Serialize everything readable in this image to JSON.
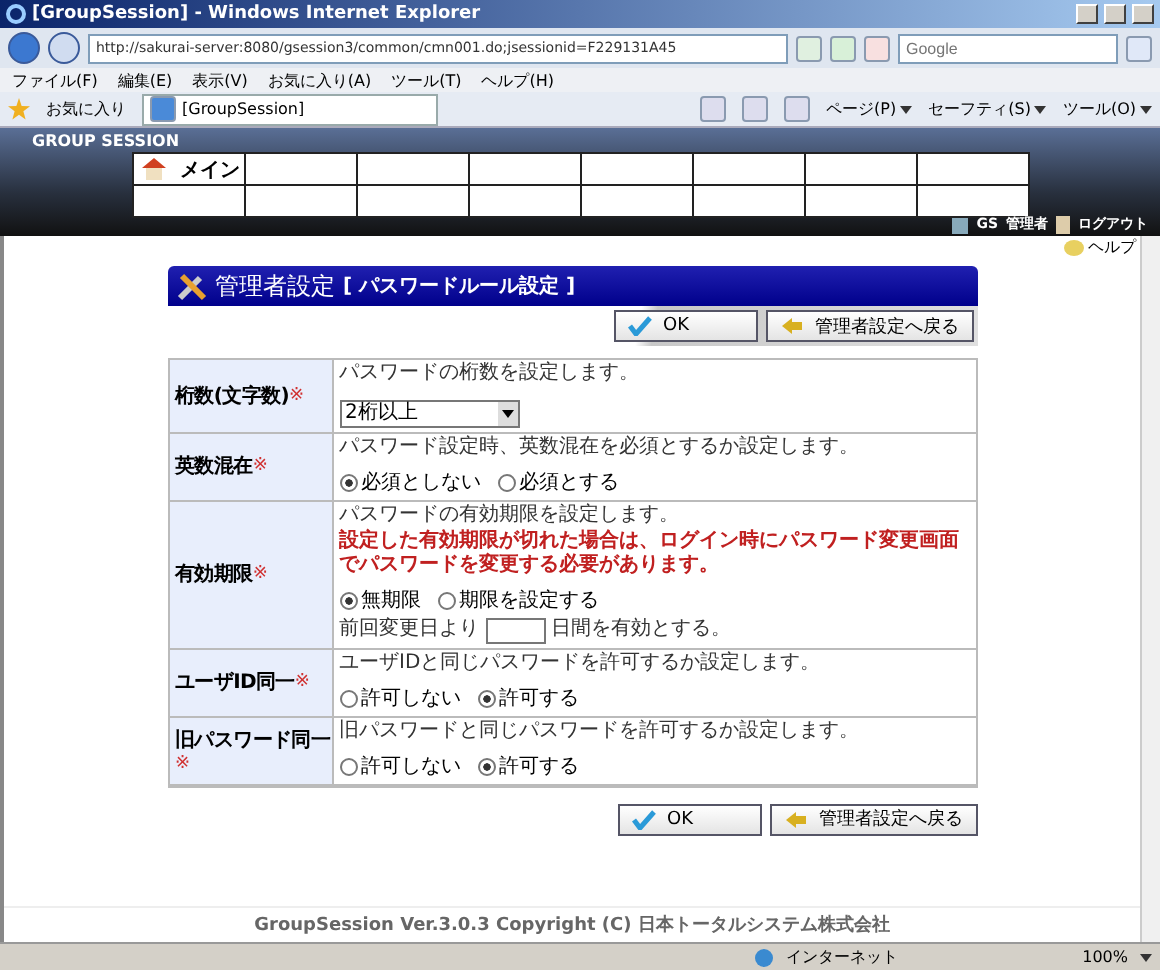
{
  "window": {
    "title": "[GroupSession] - Windows Internet Explorer"
  },
  "address_bar": {
    "url": "http://sakurai-server:8080/gsession3/common/cmn001.do;jsessionid=F229131A45",
    "search_placeholder": "Google"
  },
  "menu": [
    "ファイル(F)",
    "編集(E)",
    "表示(V)",
    "お気に入り(A)",
    "ツール(T)",
    "ヘルプ(H)"
  ],
  "favorites": {
    "label": "お気に入り",
    "tab": "[GroupSession]",
    "tools": [
      "ページ(P)",
      "セーフティ(S)",
      "ツール(O)"
    ]
  },
  "app": {
    "logo": "GROUP SESSION",
    "nav": [
      {
        "label": "メイン"
      }
    ],
    "user": "GS",
    "role": "管理者",
    "logout": "ログアウト",
    "help": "ヘルプ"
  },
  "page": {
    "title": "管理者設定",
    "subtitle": "[ パスワードルール設定 ]"
  },
  "buttons_top": [
    {
      "kind": "ok",
      "label": "OK"
    },
    {
      "kind": "back",
      "label": "管理者設定へ戻る"
    }
  ],
  "rows": [
    {
      "label": "桁数(文字数)",
      "required_mark": "※",
      "description": "パスワードの桁数を設定します。",
      "control": {
        "kind": "select",
        "value": "2桁以上"
      }
    },
    {
      "label": "英数混在",
      "required_mark": "※",
      "description": "パスワード設定時、英数混在を必須とするか設定します。",
      "control": {
        "kind": "radio",
        "options": [
          {
            "label": "必須としない",
            "selected": true
          },
          {
            "label": "必須とする",
            "selected": false
          }
        ]
      }
    },
    {
      "label": "有効期限",
      "required_mark": "※",
      "description": "パスワードの有効期限を設定します。",
      "warning": "設定した有効期限が切れた場合は、ログイン時にパスワード変更画面でパスワードを変更する必要があります。",
      "control": {
        "kind": "radio",
        "options": [
          {
            "label": "無期限",
            "selected": true
          },
          {
            "label": "期限を設定する",
            "selected": false
          }
        ]
      },
      "days": {
        "prefix": "前回変更日より",
        "suffix": "日間を有効とする。"
      }
    },
    {
      "label": "ユーザID同一",
      "required_mark": "※",
      "description": "ユーザIDと同じパスワードを許可するか設定します。",
      "control": {
        "kind": "radio",
        "options": [
          {
            "label": "許可しない",
            "selected": false
          },
          {
            "label": "許可する",
            "selected": true
          }
        ]
      }
    },
    {
      "label": "旧パスワード同一",
      "required_mark": "※",
      "description": "旧パスワードと同じパスワードを許可するか設定します。",
      "control": {
        "kind": "radio",
        "options": [
          {
            "label": "許可しない",
            "selected": false
          },
          {
            "label": "許可する",
            "selected": true
          }
        ]
      }
    }
  ],
  "buttons_bottom": [
    {
      "kind": "ok",
      "label": "OK"
    },
    {
      "kind": "back",
      "label": "管理者設定へ戻る"
    }
  ],
  "footer": "GroupSession Ver.3.0.3 Copyright (C) 日本トータルシステム株式会社",
  "status_bar": {
    "zone": "インターネット",
    "zoom": "100%"
  }
}
